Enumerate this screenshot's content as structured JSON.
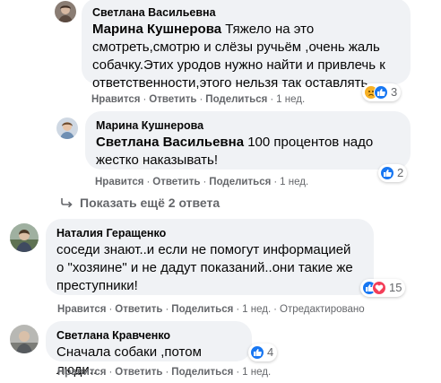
{
  "comments": [
    {
      "author": "Светлана Васильевна",
      "mention": "Марина Кушнерова",
      "lines": [
        "Тяжело на это",
        "смотреть,смотрю и слёзы ручьём ,очень жаль",
        "собачку.Этих уродов нужно найти и привлечь к",
        "ответственности,этого нельзя так оставлять."
      ],
      "reactions": {
        "icons": [
          "sad-reaction-icon",
          "like-reaction-icon"
        ],
        "count": "3"
      },
      "actions": {
        "like": "Нравится",
        "reply": "Ответить",
        "share": "Поделиться",
        "time": "1 нед."
      }
    },
    {
      "author": "Марина Кушнерова",
      "mention": "Светлана Васильевна",
      "lines": [
        " 100 процентов надо",
        "жестко наказывать!"
      ],
      "reactions": {
        "icons": [
          "like-reaction-icon"
        ],
        "count": "2"
      },
      "actions": {
        "like": "Нравится",
        "reply": "Ответить",
        "share": "Поделиться",
        "time": "1 нед."
      }
    },
    {
      "author": "Наталия Геращенко",
      "lines": [
        "соседи знают..и если не помогут информацией",
        "о \"хозяине\" и не дадут показаний..они такие же",
        "преступники!"
      ],
      "reactions": {
        "icons": [
          "like-reaction-icon",
          "love-reaction-icon"
        ],
        "count": "15"
      },
      "actions": {
        "like": "Нравится",
        "reply": "Ответить",
        "share": "Поделиться",
        "time": "1 нед.",
        "edited": "Отредактировано"
      }
    },
    {
      "author": "Светлана Кравченко",
      "lines": [
        "Сначала собаки ,потом люди.."
      ],
      "reactions": {
        "icons": [
          "like-reaction-icon"
        ],
        "count": "4"
      },
      "actions": {
        "like": "Нравится",
        "reply": "Ответить",
        "share": "Поделиться",
        "time": "1 нед."
      }
    }
  ],
  "show_more_replies": "Показать ещё 2 ответа",
  "colors": {
    "bubble": "#f0f2f5",
    "secondary_text": "#65676b",
    "like_blue": "#1877f2",
    "love_red": "#f33e58",
    "sad_yellow": "#f7b125"
  }
}
